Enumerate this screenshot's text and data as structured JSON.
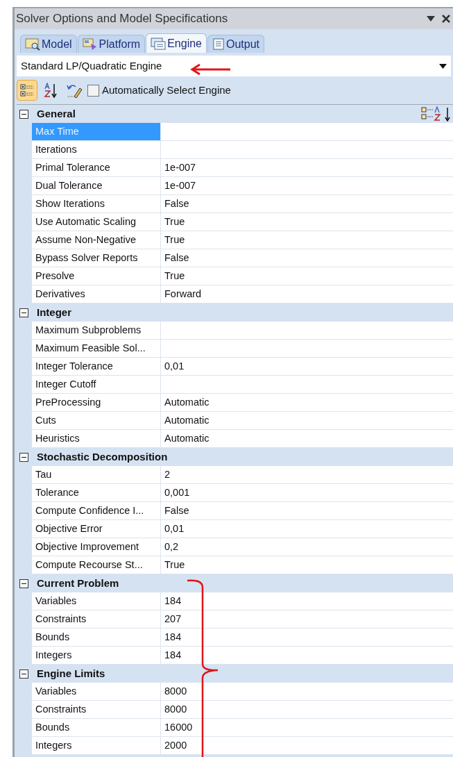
{
  "window": {
    "title": "Solver Options and Model Specifications"
  },
  "tabs": [
    {
      "label": "Model",
      "kind": "model",
      "selected": false
    },
    {
      "label": "Platform",
      "kind": "platform",
      "selected": false
    },
    {
      "label": "Engine",
      "kind": "engine",
      "selected": true
    },
    {
      "label": "Output",
      "kind": "output",
      "selected": false
    }
  ],
  "engine_select": {
    "value": "Standard LP/Quadratic Engine"
  },
  "toolbar": {
    "buttons": [
      {
        "kind": "categorized",
        "selected": true
      },
      {
        "kind": "alphabetical",
        "selected": false
      },
      {
        "kind": "reset",
        "selected": false
      }
    ],
    "auto_select": {
      "label": "Automatically Select Engine",
      "checked": false
    }
  },
  "sections": [
    {
      "title": "General",
      "expanded": true,
      "rows": [
        {
          "name": "Max Time",
          "value": "",
          "selected": true
        },
        {
          "name": "Iterations",
          "value": "",
          "selected": false
        },
        {
          "name": "Primal Tolerance",
          "value": "1e-007",
          "selected": false
        },
        {
          "name": "Dual Tolerance",
          "value": "1e-007",
          "selected": false
        },
        {
          "name": "Show Iterations",
          "value": "False",
          "selected": false
        },
        {
          "name": "Use Automatic Scaling",
          "value": "True",
          "selected": false
        },
        {
          "name": "Assume Non-Negative",
          "value": "True",
          "selected": false
        },
        {
          "name": "Bypass Solver Reports",
          "value": "False",
          "selected": false
        },
        {
          "name": "Presolve",
          "value": "True",
          "selected": false
        },
        {
          "name": "Derivatives",
          "value": "Forward",
          "selected": false
        }
      ]
    },
    {
      "title": "Integer",
      "expanded": true,
      "rows": [
        {
          "name": "Maximum Subproblems",
          "value": "",
          "selected": false
        },
        {
          "name": "Maximum Feasible Sol...",
          "value": "",
          "selected": false
        },
        {
          "name": "Integer Tolerance",
          "value": "0,01",
          "selected": false
        },
        {
          "name": "Integer Cutoff",
          "value": "",
          "selected": false
        },
        {
          "name": "PreProcessing",
          "value": "Automatic",
          "selected": false
        },
        {
          "name": "Cuts",
          "value": "Automatic",
          "selected": false
        },
        {
          "name": "Heuristics",
          "value": "Automatic",
          "selected": false
        }
      ]
    },
    {
      "title": "Stochastic Decomposition",
      "expanded": true,
      "rows": [
        {
          "name": "Tau",
          "value": "2",
          "selected": false
        },
        {
          "name": "Tolerance",
          "value": "0,001",
          "selected": false
        },
        {
          "name": "Compute Confidence I...",
          "value": "False",
          "selected": false
        },
        {
          "name": "Objective Error",
          "value": "0,01",
          "selected": false
        },
        {
          "name": "Objective Improvement",
          "value": "0,2",
          "selected": false
        },
        {
          "name": "Compute Recourse St...",
          "value": "True",
          "selected": false
        }
      ]
    },
    {
      "title": "Current Problem",
      "expanded": true,
      "rows": [
        {
          "name": "Variables",
          "value": "184",
          "selected": false
        },
        {
          "name": "Constraints",
          "value": "207",
          "selected": false
        },
        {
          "name": "Bounds",
          "value": "184",
          "selected": false
        },
        {
          "name": "Integers",
          "value": "184",
          "selected": false
        }
      ]
    },
    {
      "title": "Engine Limits",
      "expanded": true,
      "rows": [
        {
          "name": "Variables",
          "value": "8000",
          "selected": false
        },
        {
          "name": "Constraints",
          "value": "8000",
          "selected": false
        },
        {
          "name": "Bounds",
          "value": "16000",
          "selected": false
        },
        {
          "name": "Integers",
          "value": "2000",
          "selected": false
        }
      ]
    }
  ]
}
